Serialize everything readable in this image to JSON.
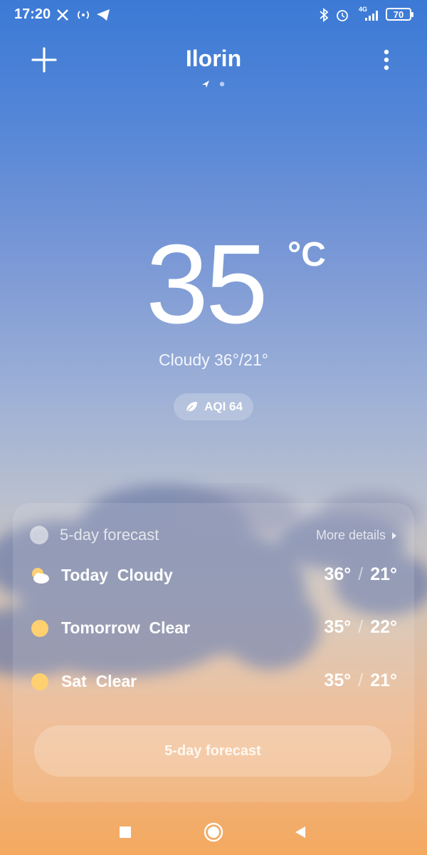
{
  "status_bar": {
    "time": "17:20",
    "network": "4G",
    "battery": "70",
    "icons": [
      "x-icon",
      "hotspot-icon",
      "telegram-icon",
      "bluetooth-icon",
      "alarm-icon",
      "signal-icon"
    ]
  },
  "header": {
    "city": "Ilorin",
    "add_icon": "plus-icon",
    "menu_icon": "more-vertical-icon"
  },
  "current": {
    "temperature": "35",
    "unit": "°C",
    "condition_line": "Cloudy  36°/21°",
    "aqi": "AQI 64"
  },
  "forecast": {
    "title": "5-day forecast",
    "more_details": "More details",
    "rows": [
      {
        "label": "Today  Cloudy",
        "high": "36°",
        "low": "21°",
        "icon": "partly-cloudy-icon"
      },
      {
        "label": "Tomorrow  Clear",
        "high": "35°",
        "low": "22°",
        "icon": "sun-icon"
      },
      {
        "label": "Sat  Clear",
        "high": "35°",
        "low": "21°",
        "icon": "sun-icon"
      }
    ],
    "slash": "/",
    "button_label": "5-day forecast"
  },
  "colors": {
    "sky_top": "#3b7ad6",
    "sky_bottom": "#f4a95f",
    "sun": "#ffd070"
  }
}
